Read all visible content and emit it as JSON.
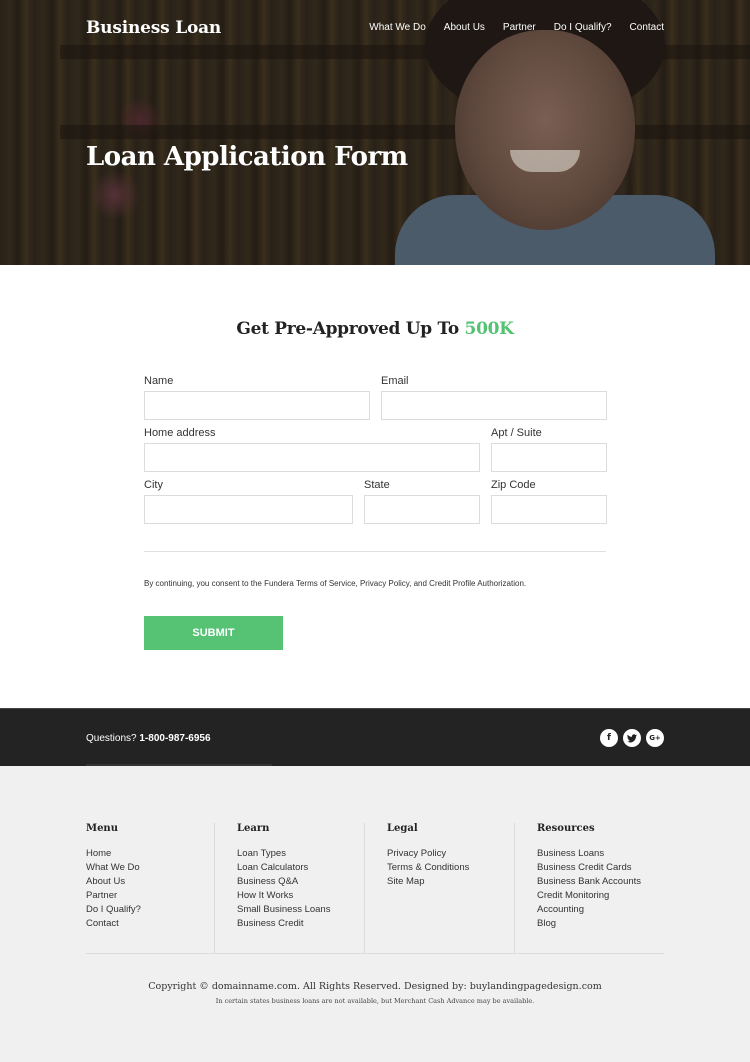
{
  "header": {
    "brand": "Business Loan",
    "nav": [
      "What We Do",
      "About Us",
      "Partner",
      "Do I Qualify?",
      "Contact"
    ]
  },
  "hero": {
    "title": "Loan Application Form"
  },
  "form": {
    "heading_prefix": "Get Pre-Approved Up To",
    "heading_accent": "500K",
    "fields": {
      "name": {
        "label": "Name",
        "value": ""
      },
      "email": {
        "label": "Email",
        "value": ""
      },
      "home_address": {
        "label": "Home address",
        "value": ""
      },
      "apt_suite": {
        "label": "Apt / Suite",
        "value": ""
      },
      "city": {
        "label": "City",
        "value": ""
      },
      "state": {
        "label": "State",
        "value": ""
      },
      "zip_code": {
        "label": "Zip Code",
        "value": ""
      }
    },
    "consent": "By continuing, you consent to the Fundera Terms of Service, Privacy Policy, and Credit Profile Authorization.",
    "submit_label": "SUBMIT"
  },
  "contact_bar": {
    "question": "Questions?",
    "phone": "1-800-987-6956",
    "socials": [
      {
        "icon": "facebook-icon",
        "glyph": "f"
      },
      {
        "icon": "twitter-icon",
        "glyph": "t"
      },
      {
        "icon": "google-plus-icon",
        "glyph": "G+"
      }
    ]
  },
  "footer": {
    "columns": [
      {
        "title": "Menu",
        "items": [
          "Home",
          "What We Do",
          "About Us",
          "Partner",
          "Do I Qualify?",
          "Contact"
        ]
      },
      {
        "title": "Learn",
        "items": [
          "Loan Types",
          "Loan Calculators",
          "Business Q&A",
          "How It Works",
          "Small Business Loans",
          "Business Credit"
        ]
      },
      {
        "title": "Legal",
        "items": [
          "Privacy Policy",
          "Terms & Conditions",
          "Site Map"
        ]
      },
      {
        "title": "Resources",
        "items": [
          "Business Loans",
          "Business Credit Cards",
          "Business Bank Accounts",
          "Credit Monitoring",
          "Accounting",
          "Blog"
        ]
      }
    ],
    "copyright": "Copyright © domainname.com. All Rights Reserved. Designed by: buylandingpagedesign.com",
    "disclaimer": "In certain states business loans are not available, but Merchant Cash Advance may be available."
  },
  "colors": {
    "accent_green": "#55c274",
    "contact_bar_bg": "#232323",
    "footer_bg": "#f0f0f0"
  }
}
